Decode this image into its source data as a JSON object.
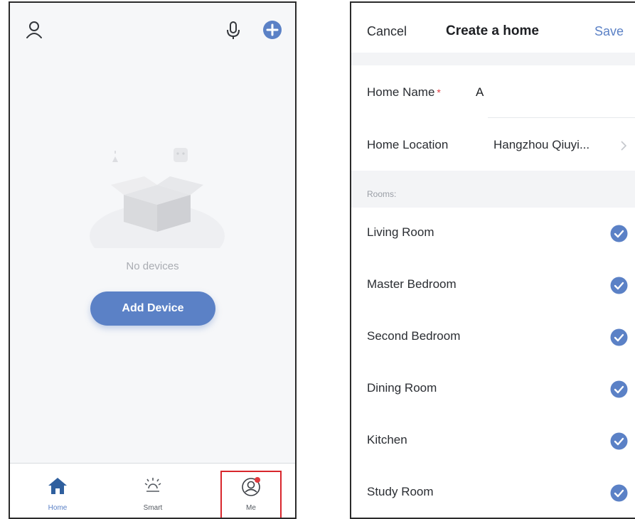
{
  "home_screen": {
    "empty_state_text": "No devices",
    "add_device_label": "Add Device",
    "nav": [
      {
        "label": "Home",
        "icon": "home-icon"
      },
      {
        "label": "Smart",
        "icon": "sun-icon"
      },
      {
        "label": "Me",
        "icon": "profile-icon"
      }
    ],
    "top_icons": [
      "user-icon",
      "microphone-icon",
      "add-circle-icon"
    ]
  },
  "create_home": {
    "cancel_label": "Cancel",
    "title": "Create a home",
    "save_label": "Save",
    "home_name_label": "Home Name",
    "required_mark": "*",
    "home_name_value": "A",
    "home_location_label": "Home Location",
    "home_location_value": "Hangzhou Qiuyi...",
    "rooms_header": "Rooms:",
    "rooms": [
      {
        "name": "Living Room",
        "checked": true
      },
      {
        "name": "Master Bedroom",
        "checked": true
      },
      {
        "name": "Second Bedroom",
        "checked": true
      },
      {
        "name": "Dining Room",
        "checked": true
      },
      {
        "name": "Kitchen",
        "checked": true
      },
      {
        "name": "Study Room",
        "checked": true
      }
    ]
  },
  "colors": {
    "accent": "#5b81c6",
    "required": "#e0393e",
    "badge": "#e0393e",
    "highlight_box": "#d8262c"
  }
}
